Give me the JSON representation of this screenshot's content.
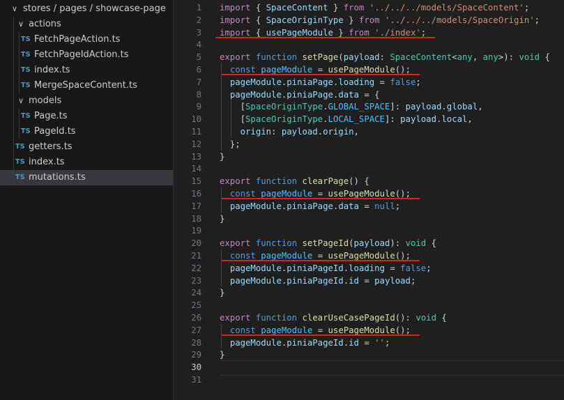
{
  "explorer": {
    "root_folder": "stores / pages / showcase-page",
    "items": [
      {
        "type": "folder",
        "label": "actions",
        "depth": 1,
        "expanded": true
      },
      {
        "type": "file",
        "label": "FetchPageAction.ts",
        "depth": 2,
        "icon": "TS"
      },
      {
        "type": "file",
        "label": "FetchPageIdAction.ts",
        "depth": 2,
        "icon": "TS"
      },
      {
        "type": "file",
        "label": "index.ts",
        "depth": 2,
        "icon": "TS"
      },
      {
        "type": "file",
        "label": "MergeSpaceContent.ts",
        "depth": 2,
        "icon": "TS"
      },
      {
        "type": "folder",
        "label": "models",
        "depth": 1,
        "expanded": true
      },
      {
        "type": "file",
        "label": "Page.ts",
        "depth": 2,
        "icon": "TS"
      },
      {
        "type": "file",
        "label": "PageId.ts",
        "depth": 2,
        "icon": "TS"
      },
      {
        "type": "file",
        "label": "getters.ts",
        "depth": 1,
        "icon": "TS"
      },
      {
        "type": "file",
        "label": "index.ts",
        "depth": 1,
        "icon": "TS"
      },
      {
        "type": "file",
        "label": "mutations.ts",
        "depth": 1,
        "icon": "TS",
        "selected": true
      }
    ]
  },
  "editor": {
    "active_line": 30,
    "lines": [
      [
        [
          "kw-i",
          "import"
        ],
        [
          "pun",
          " { "
        ],
        [
          "var",
          "SpaceContent"
        ],
        [
          "pun",
          " } "
        ],
        [
          "kw-i",
          "from"
        ],
        [
          "pun",
          " "
        ],
        [
          "str",
          "'../../../models/SpaceContent'"
        ],
        [
          "pun",
          ";"
        ]
      ],
      [
        [
          "kw-i",
          "import"
        ],
        [
          "pun",
          " { "
        ],
        [
          "var",
          "SpaceOriginType"
        ],
        [
          "pun",
          " } "
        ],
        [
          "kw-i",
          "from"
        ],
        [
          "pun",
          " "
        ],
        [
          "str",
          "'../../../models/SpaceOrigin'"
        ],
        [
          "pun",
          ";"
        ]
      ],
      [
        [
          "kw-i",
          "import"
        ],
        [
          "pun",
          " { "
        ],
        [
          "var",
          "usePageModule"
        ],
        [
          "pun",
          " } "
        ],
        [
          "kw-i",
          "from"
        ],
        [
          "pun",
          " "
        ],
        [
          "str",
          "'./index'"
        ],
        [
          "pun",
          ";"
        ]
      ],
      [],
      [
        [
          "kw-i",
          "export"
        ],
        [
          "pun",
          " "
        ],
        [
          "kw",
          "function"
        ],
        [
          "pun",
          " "
        ],
        [
          "fn",
          "setPage"
        ],
        [
          "pun",
          "("
        ],
        [
          "var",
          "payload"
        ],
        [
          "pun",
          ": "
        ],
        [
          "ty",
          "SpaceContent"
        ],
        [
          "pun",
          "<"
        ],
        [
          "ty",
          "any"
        ],
        [
          "pun",
          ", "
        ],
        [
          "ty",
          "any"
        ],
        [
          "pun",
          ">): "
        ],
        [
          "ty",
          "void"
        ],
        [
          "pun",
          " {"
        ]
      ],
      [
        [
          "pun",
          "  "
        ],
        [
          "kw",
          "const"
        ],
        [
          "pun",
          " "
        ],
        [
          "vb",
          "pageModule"
        ],
        [
          "pun",
          " = "
        ],
        [
          "fn",
          "usePageModule"
        ],
        [
          "pun",
          "();"
        ]
      ],
      [
        [
          "pun",
          "  "
        ],
        [
          "var",
          "pageModule"
        ],
        [
          "pun",
          "."
        ],
        [
          "var",
          "piniaPage"
        ],
        [
          "pun",
          "."
        ],
        [
          "var",
          "loading"
        ],
        [
          "pun",
          " = "
        ],
        [
          "kw",
          "false"
        ],
        [
          "pun",
          ";"
        ]
      ],
      [
        [
          "pun",
          "  "
        ],
        [
          "var",
          "pageModule"
        ],
        [
          "pun",
          "."
        ],
        [
          "var",
          "piniaPage"
        ],
        [
          "pun",
          "."
        ],
        [
          "var",
          "data"
        ],
        [
          "pun",
          " = {"
        ]
      ],
      [
        [
          "pun",
          "    ["
        ],
        [
          "ty",
          "SpaceOriginType"
        ],
        [
          "pun",
          "."
        ],
        [
          "vb",
          "GLOBAL_SPACE"
        ],
        [
          "pun",
          "]: "
        ],
        [
          "var",
          "payload"
        ],
        [
          "pun",
          "."
        ],
        [
          "var",
          "global"
        ],
        [
          "pun",
          ","
        ]
      ],
      [
        [
          "pun",
          "    ["
        ],
        [
          "ty",
          "SpaceOriginType"
        ],
        [
          "pun",
          "."
        ],
        [
          "vb",
          "LOCAL_SPACE"
        ],
        [
          "pun",
          "]: "
        ],
        [
          "var",
          "payload"
        ],
        [
          "pun",
          "."
        ],
        [
          "var",
          "local"
        ],
        [
          "pun",
          ","
        ]
      ],
      [
        [
          "pun",
          "    "
        ],
        [
          "var",
          "origin"
        ],
        [
          "pun",
          ": "
        ],
        [
          "var",
          "payload"
        ],
        [
          "pun",
          "."
        ],
        [
          "var",
          "origin"
        ],
        [
          "pun",
          ","
        ]
      ],
      [
        [
          "pun",
          "  };"
        ]
      ],
      [
        [
          "pun",
          "}"
        ]
      ],
      [],
      [
        [
          "kw-i",
          "export"
        ],
        [
          "pun",
          " "
        ],
        [
          "kw",
          "function"
        ],
        [
          "pun",
          " "
        ],
        [
          "fn",
          "clearPage"
        ],
        [
          "pun",
          "() {"
        ]
      ],
      [
        [
          "pun",
          "  "
        ],
        [
          "kw",
          "const"
        ],
        [
          "pun",
          " "
        ],
        [
          "vb",
          "pageModule"
        ],
        [
          "pun",
          " = "
        ],
        [
          "fn",
          "usePageModule"
        ],
        [
          "pun",
          "();"
        ]
      ],
      [
        [
          "pun",
          "  "
        ],
        [
          "var",
          "pageModule"
        ],
        [
          "pun",
          "."
        ],
        [
          "var",
          "piniaPage"
        ],
        [
          "pun",
          "."
        ],
        [
          "var",
          "data"
        ],
        [
          "pun",
          " = "
        ],
        [
          "kw",
          "null"
        ],
        [
          "pun",
          ";"
        ]
      ],
      [
        [
          "pun",
          "}"
        ]
      ],
      [],
      [
        [
          "kw-i",
          "export"
        ],
        [
          "pun",
          " "
        ],
        [
          "kw",
          "function"
        ],
        [
          "pun",
          " "
        ],
        [
          "fn",
          "setPageId"
        ],
        [
          "pun",
          "("
        ],
        [
          "var",
          "payload"
        ],
        [
          "pun",
          "): "
        ],
        [
          "ty",
          "void"
        ],
        [
          "pun",
          " {"
        ]
      ],
      [
        [
          "pun",
          "  "
        ],
        [
          "kw",
          "const"
        ],
        [
          "pun",
          " "
        ],
        [
          "vb",
          "pageModule"
        ],
        [
          "pun",
          " = "
        ],
        [
          "fn",
          "usePageModule"
        ],
        [
          "pun",
          "();"
        ]
      ],
      [
        [
          "pun",
          "  "
        ],
        [
          "var",
          "pageModule"
        ],
        [
          "pun",
          "."
        ],
        [
          "var",
          "piniaPageId"
        ],
        [
          "pun",
          "."
        ],
        [
          "var",
          "loading"
        ],
        [
          "pun",
          " = "
        ],
        [
          "kw",
          "false"
        ],
        [
          "pun",
          ";"
        ]
      ],
      [
        [
          "pun",
          "  "
        ],
        [
          "var",
          "pageModule"
        ],
        [
          "pun",
          "."
        ],
        [
          "var",
          "piniaPageId"
        ],
        [
          "pun",
          "."
        ],
        [
          "var",
          "id"
        ],
        [
          "pun",
          " = "
        ],
        [
          "var",
          "payload"
        ],
        [
          "pun",
          ";"
        ]
      ],
      [
        [
          "pun",
          "}"
        ]
      ],
      [],
      [
        [
          "kw-i",
          "export"
        ],
        [
          "pun",
          " "
        ],
        [
          "kw",
          "function"
        ],
        [
          "pun",
          " "
        ],
        [
          "fn",
          "clearUseCasePageId"
        ],
        [
          "pun",
          "(): "
        ],
        [
          "ty",
          "void"
        ],
        [
          "pun",
          " {"
        ]
      ],
      [
        [
          "pun",
          "  "
        ],
        [
          "kw",
          "const"
        ],
        [
          "pun",
          " "
        ],
        [
          "vb",
          "pageModule"
        ],
        [
          "pun",
          " = "
        ],
        [
          "fn",
          "usePageModule"
        ],
        [
          "pun",
          "();"
        ]
      ],
      [
        [
          "pun",
          "  "
        ],
        [
          "var",
          "pageModule"
        ],
        [
          "pun",
          "."
        ],
        [
          "var",
          "piniaPageId"
        ],
        [
          "pun",
          "."
        ],
        [
          "var",
          "id"
        ],
        [
          "pun",
          " = "
        ],
        [
          "str",
          "''"
        ],
        [
          "pun",
          ";"
        ]
      ],
      [
        [
          "pun",
          "}"
        ]
      ],
      [],
      []
    ],
    "highlight_underlines": [
      3,
      6,
      16,
      21,
      27
    ],
    "underline_color": "#e0201a"
  }
}
